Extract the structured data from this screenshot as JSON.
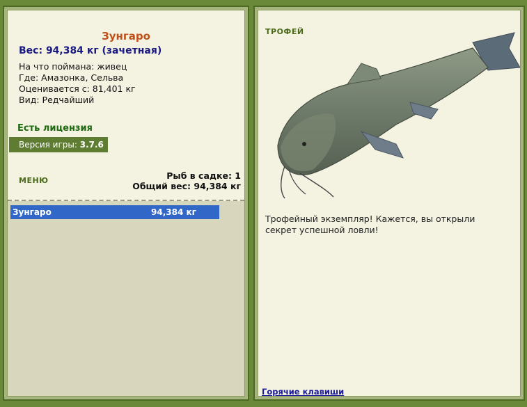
{
  "catch": {
    "fish_name": "Зунгаро",
    "weight_line": "Вес: 94,384 кг (зачетная)",
    "bait_line": "На что поймана: живец",
    "location_line": "Где: Амазонка, Сельва",
    "valued_line": "Оценивается с: 81,401 кг",
    "rarity_line": "Вид: Редчайший"
  },
  "license_text": "Есть лицензия",
  "version": {
    "label": "Версия игры:",
    "value": "3.7.6"
  },
  "menu_label": "МЕНЮ",
  "keepnet": {
    "count_line": "Рыб в садке: 1",
    "total_line": "Общий вес: 94,384 кг",
    "rows": [
      {
        "name": "Зунгаро",
        "weight": "94,384 кг"
      }
    ]
  },
  "trophy_label": "ТРОФЕЙ",
  "trophy_description": "Трофейный экземпляр! Кажется, вы открыли секрет успешной ловли!",
  "hotkeys_link": "Горячие клавиши",
  "colors": {
    "frame_green": "#6a8a3a",
    "panel_bg": "#f4f2e1",
    "selection_blue": "#3168c8",
    "fish_name_orange": "#c0501a",
    "weight_navy": "#1a1a80",
    "license_green": "#1e6a10"
  }
}
